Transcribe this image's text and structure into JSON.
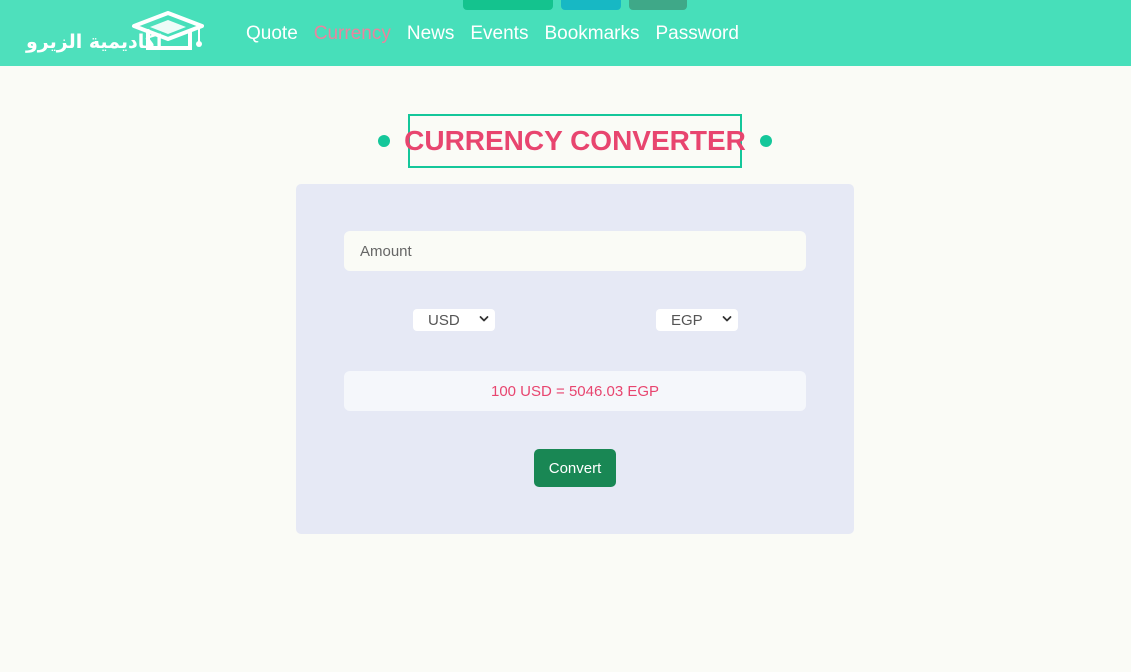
{
  "brand": {
    "name": "اكاديمية الزيرو",
    "logo_icon": "graduation-cap-icon"
  },
  "nav": {
    "links": [
      {
        "label": "Quote",
        "active": false
      },
      {
        "label": "Currency",
        "active": true
      },
      {
        "label": "News",
        "active": false
      },
      {
        "label": "Events",
        "active": false
      },
      {
        "label": "Bookmarks",
        "active": false
      },
      {
        "label": "Password",
        "active": false
      }
    ]
  },
  "title": "CURRENCY CONVERTER",
  "converter": {
    "amount_placeholder": "Amount",
    "amount_value": "",
    "from_currency": "USD",
    "to_currency": "EGP",
    "result": "100 USD = 5046.03 EGP",
    "convert_label": "Convert"
  },
  "colors": {
    "navbar": "#47dfba",
    "accent_pink": "#e8456f",
    "accent_green": "#14c79a",
    "button": "#198754",
    "card": "#e6e9f5"
  }
}
